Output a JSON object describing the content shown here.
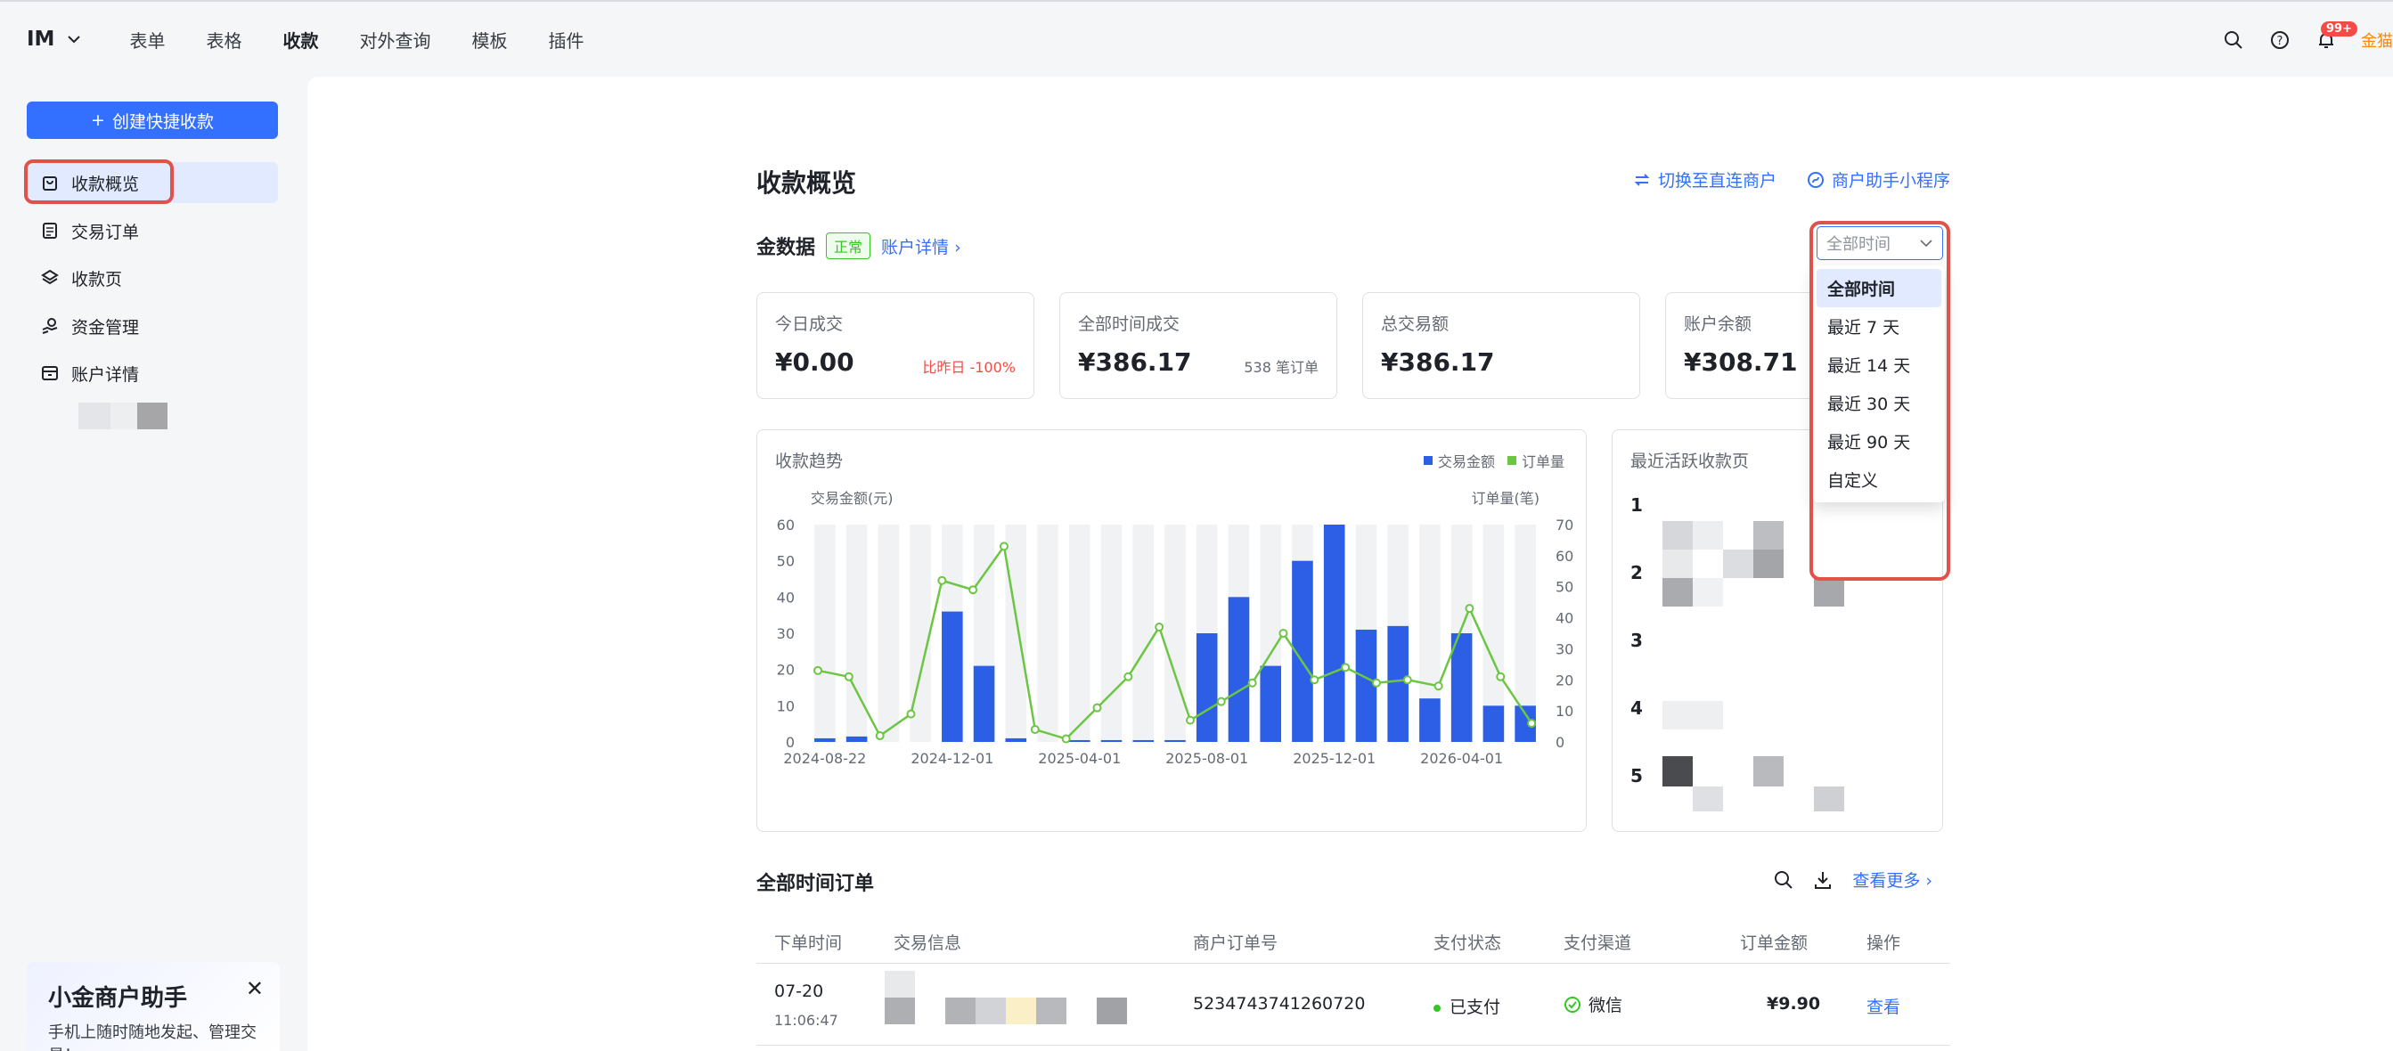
{
  "topbar": {
    "workspace": "IM",
    "nav": [
      "表单",
      "表格",
      "收款",
      "对外查询",
      "模板",
      "插件"
    ],
    "active_nav": "收款",
    "notification_badge": "99+",
    "avatar_fragment": "金猫"
  },
  "sidebar": {
    "create_label": "创建快捷收款",
    "items": [
      {
        "label": "收款概览",
        "icon": "bag-icon",
        "active": true
      },
      {
        "label": "交易订单",
        "icon": "document-icon",
        "active": false
      },
      {
        "label": "收款页",
        "icon": "layers-icon",
        "active": false
      },
      {
        "label": "资金管理",
        "icon": "money-hand-icon",
        "active": false
      },
      {
        "label": "账户详情",
        "icon": "archive-icon",
        "active": false
      }
    ],
    "promo": {
      "title": "小金商户助手",
      "subtitle": "手机上随时随地发起、管理交易！"
    }
  },
  "page": {
    "title": "收款概览",
    "links": [
      "切换至直连商户",
      "商户助手小程序"
    ],
    "data_title": "金数据",
    "status_tag": "正常",
    "account_link": "账户详情"
  },
  "time_filter": {
    "value": "全部时间",
    "options": [
      "全部时间",
      "最近 7 天",
      "最近 14 天",
      "最近 30 天",
      "最近 90 天",
      "自定义"
    ],
    "selected": "全部时间"
  },
  "stats": [
    {
      "label": "今日成交",
      "value": "¥0.00",
      "note": "比昨日 -100%"
    },
    {
      "label": "全部时间成交",
      "value": "¥386.17",
      "note": "538 笔订单"
    },
    {
      "label": "总交易额",
      "value": "¥386.17",
      "note": ""
    },
    {
      "label": "账户余额",
      "value": "¥308.71",
      "note": ""
    }
  ],
  "trend": {
    "title": "收款趋势",
    "legend": [
      "交易金额",
      "订单量"
    ]
  },
  "chart_data": {
    "type": "bar",
    "title": "收款趋势",
    "y_left_label": "交易金额(元)",
    "y_right_label": "订单量(笔)",
    "y_left_ticks": [
      0,
      10,
      20,
      30,
      40,
      50,
      60
    ],
    "y_right_ticks": [
      0,
      10,
      20,
      30,
      40,
      50,
      60,
      70
    ],
    "ylim_left": [
      0,
      60
    ],
    "ylim_right": [
      0,
      70
    ],
    "x_tick_labels": [
      "2024-08-22",
      "2024-12-01",
      "2025-04-01",
      "2025-08-01",
      "2025-12-01",
      "2026-04-01"
    ],
    "x_tick_positions": [
      0,
      4,
      8,
      12,
      16,
      20
    ],
    "series": [
      {
        "name": "交易金额",
        "type": "bar",
        "color": "#2d5fe6",
        "axis": "left",
        "values": [
          1,
          1.5,
          0,
          0,
          36,
          21,
          1,
          0,
          0.5,
          0.5,
          0.5,
          0.5,
          30,
          40,
          21,
          50,
          60,
          31,
          32,
          12,
          30,
          10,
          10
        ]
      },
      {
        "name": "订单量",
        "type": "line",
        "color": "#6cc644",
        "axis": "right",
        "values": [
          23,
          21,
          2,
          9,
          52,
          49,
          63,
          4,
          1,
          11,
          21,
          37,
          7,
          13,
          19,
          35,
          20,
          24,
          19,
          20,
          18,
          43,
          21,
          6
        ]
      }
    ],
    "background_bar_max": 60,
    "grid": false
  },
  "rank": {
    "title": "最近活跃收款页",
    "numbers": [
      "1",
      "2",
      "3",
      "4",
      "5"
    ]
  },
  "orders": {
    "title": "全部时间订单",
    "more": "查看更多",
    "columns": [
      "下单时间",
      "交易信息",
      "商户订单号",
      "支付状态",
      "支付渠道",
      "订单金额",
      "操作"
    ],
    "rows": [
      {
        "date": "07-20",
        "time": "11:06:47",
        "order_no": "5234743741260720",
        "status": "已支付",
        "channel": "微信",
        "amount": "¥9.90",
        "action": "查看"
      }
    ]
  }
}
